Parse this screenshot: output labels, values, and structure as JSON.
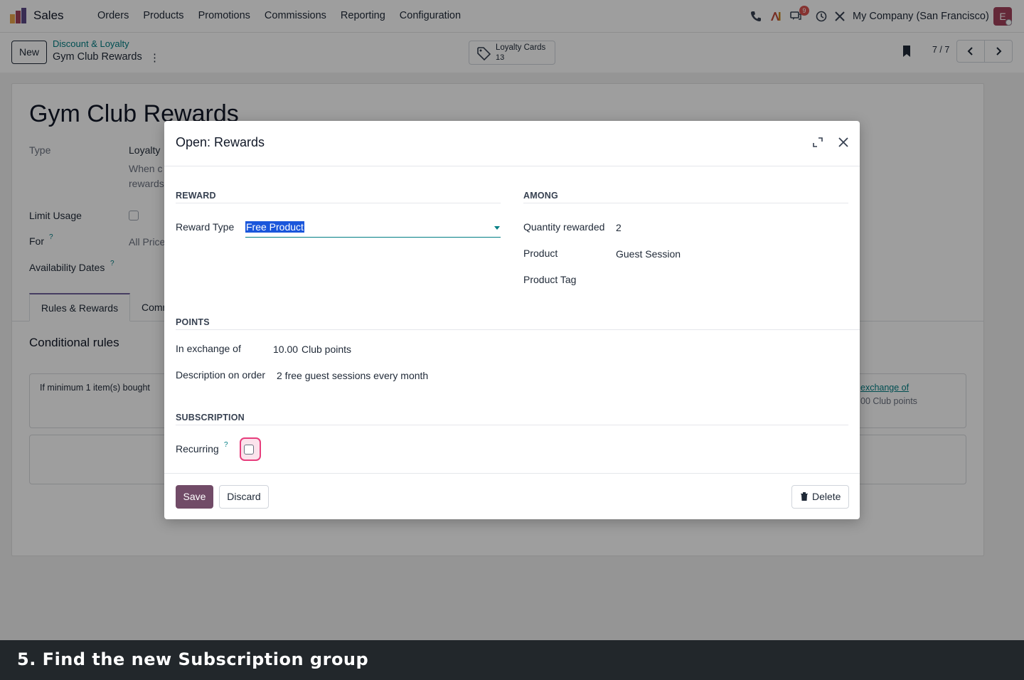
{
  "navbar": {
    "app_name": "Sales",
    "menu": [
      "Orders",
      "Products",
      "Promotions",
      "Commissions",
      "Reporting",
      "Configuration"
    ],
    "messages_badge": "9",
    "company": "My Company (San Francisco)",
    "avatar_initial": "E",
    "logo_colors": [
      "#e8a34b",
      "#a2415b",
      "#5c4a87"
    ]
  },
  "control_panel": {
    "new_label": "New",
    "breadcrumb_parent": "Discount & Loyalty",
    "breadcrumb_current": "Gym Club Rewards",
    "smart_button_label": "Loyalty Cards",
    "smart_button_value": "13",
    "pager_value": "7 / 7"
  },
  "form": {
    "title": "Gym Club Rewards",
    "type_label": "Type",
    "type_value": "Loyalty",
    "type_help_line1": "When c",
    "type_help_line2": "rewards",
    "limit_usage_label": "Limit Usage",
    "for_label": "For",
    "for_value": "All Price",
    "availability_label": "Availability Dates",
    "tab_rules": "Rules & Rewards",
    "tab_other": "Comm",
    "conditional_rules": "Conditional rules",
    "rule_text": "If minimum 1 item(s) bought",
    "reward_link": "exchange of",
    "reward_points": "00 Club points"
  },
  "modal": {
    "title": "Open: Rewards",
    "reward_section": "REWARD",
    "among_section": "AMONG",
    "reward_type_label": "Reward Type",
    "reward_type_value": "Free Product",
    "quantity_label": "Quantity rewarded",
    "quantity_value": "2",
    "product_label": "Product",
    "product_value": "Guest Session",
    "product_tag_label": "Product Tag",
    "points_section": "POINTS",
    "exchange_label": "In exchange of",
    "exchange_value": "10.00",
    "exchange_unit": "Club points",
    "description_label": "Description on order",
    "description_value": "2 free guest sessions every month",
    "subscription_section": "SUBSCRIPTION",
    "recurring_label": "Recurring",
    "help_mark": "?",
    "save_label": "Save",
    "discard_label": "Discard",
    "delete_label": "Delete"
  },
  "caption": {
    "text": "5. Find the new Subscription group"
  },
  "colors": {
    "brand_primary": "#714b67",
    "link_teal": "#017e84",
    "highlight_pink": "#e73d7c",
    "selection_blue": "#1a56db"
  }
}
